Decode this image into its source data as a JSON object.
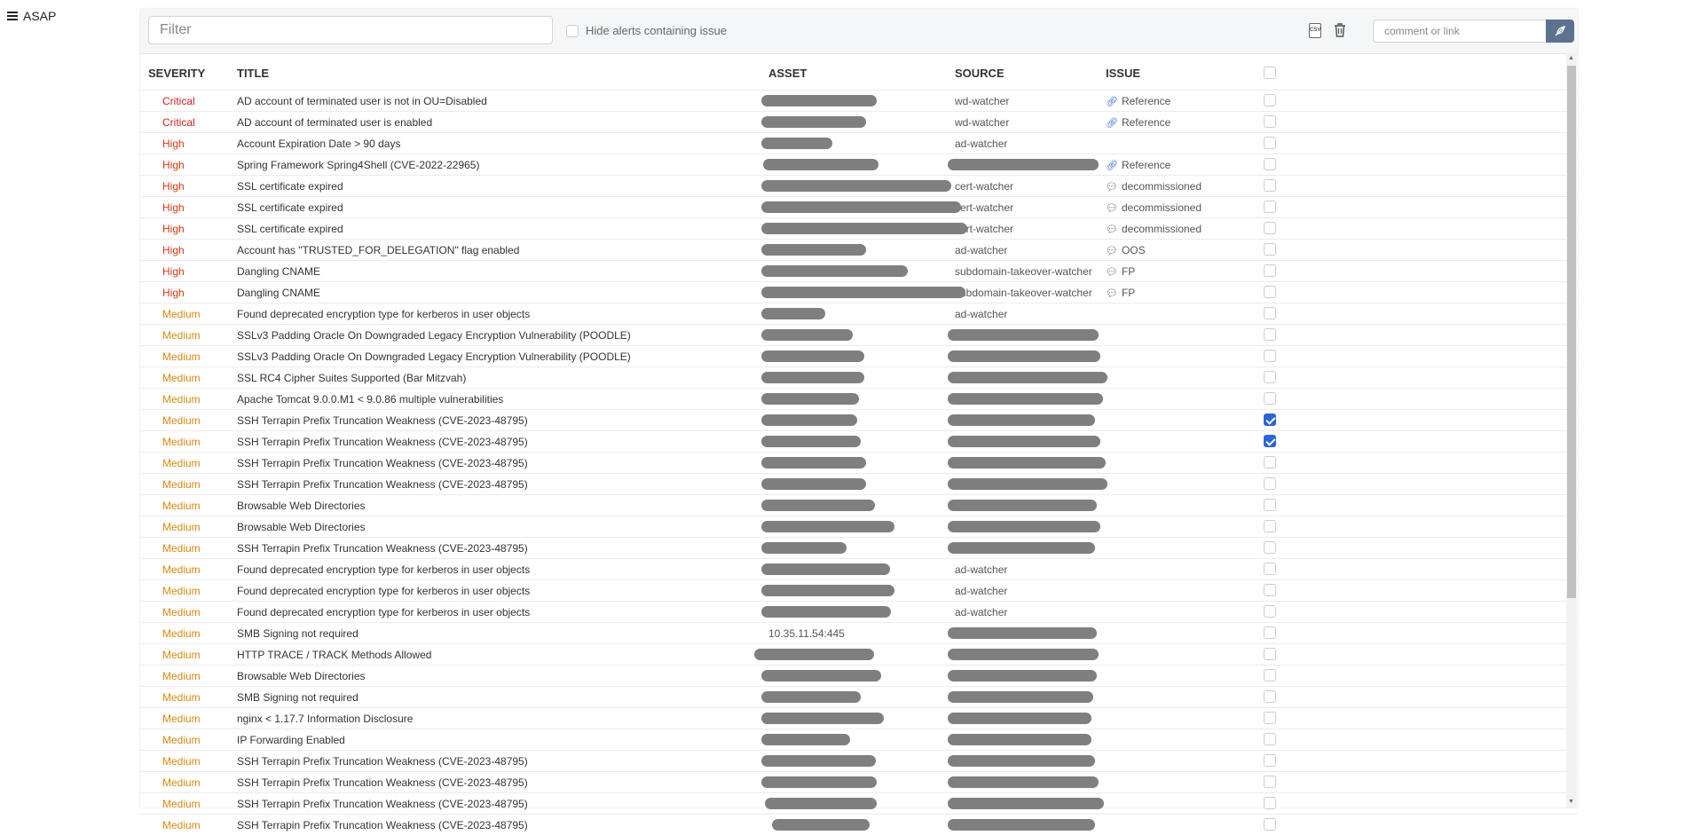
{
  "app": {
    "title": "ASAP"
  },
  "toolbar": {
    "filter_placeholder": "Filter",
    "hide_label": "Hide alerts containing issue",
    "comment_placeholder": "comment or link",
    "csv_label": "CSV"
  },
  "headers": {
    "severity": "SEVERITY",
    "title": "TITLE",
    "asset": "ASSET",
    "source": "SOURCE",
    "issue": "ISSUE"
  },
  "colors": {
    "critical": "#d02020",
    "high": "#d83a10",
    "medium": "#d78a10",
    "accent": "#2b63d9"
  },
  "rows": [
    {
      "severity": "Critical",
      "title": "AD account of terminated user is not in OU=Disabled",
      "asset": "",
      "source": "wd-watcher",
      "issue": "Reference",
      "issue_icon": "link-icon",
      "checked": false
    },
    {
      "severity": "Critical",
      "title": "AD account of terminated user is enabled",
      "asset": "",
      "source": "wd-watcher",
      "issue": "Reference",
      "issue_icon": "link-icon",
      "checked": false
    },
    {
      "severity": "High",
      "title": "Account Expiration Date > 90 days",
      "asset": "",
      "source": "ad-watcher",
      "issue": "",
      "issue_icon": "",
      "checked": false
    },
    {
      "severity": "High",
      "title": "Spring Framework Spring4Shell (CVE-2022-22965)",
      "asset": "",
      "source": "",
      "issue": "Reference",
      "issue_icon": "link-icon",
      "checked": false
    },
    {
      "severity": "High",
      "title": "SSL certificate expired",
      "asset": "",
      "source": "cert-watcher",
      "issue": "decommissioned",
      "issue_icon": "comment-icon",
      "checked": false
    },
    {
      "severity": "High",
      "title": "SSL certificate expired",
      "asset": "",
      "source": "cert-watcher",
      "issue": "decommissioned",
      "issue_icon": "comment-icon",
      "checked": false
    },
    {
      "severity": "High",
      "title": "SSL certificate expired",
      "asset": "",
      "source": "cert-watcher",
      "issue": "decommissioned",
      "issue_icon": "comment-icon",
      "checked": false
    },
    {
      "severity": "High",
      "title": "Account has \"TRUSTED_FOR_DELEGATION\" flag enabled",
      "asset": "",
      "source": "ad-watcher",
      "issue": "OOS",
      "issue_icon": "comment-icon",
      "checked": false
    },
    {
      "severity": "High",
      "title": "Dangling CNAME",
      "asset": "",
      "source": "subdomain-takeover-watcher",
      "issue": "FP",
      "issue_icon": "comment-icon",
      "checked": false
    },
    {
      "severity": "High",
      "title": "Dangling CNAME",
      "asset": "",
      "source": "subdomain-takeover-watcher",
      "issue": "FP",
      "issue_icon": "comment-icon",
      "checked": false
    },
    {
      "severity": "Medium",
      "title": "Found deprecated encryption type for kerberos in user objects",
      "asset": "",
      "source": "ad-watcher",
      "issue": "",
      "issue_icon": "",
      "checked": false
    },
    {
      "severity": "Medium",
      "title": "SSLv3 Padding Oracle On Downgraded Legacy Encryption Vulnerability (POODLE)",
      "asset": "",
      "source": "",
      "issue": "",
      "issue_icon": "",
      "checked": false
    },
    {
      "severity": "Medium",
      "title": "SSLv3 Padding Oracle On Downgraded Legacy Encryption Vulnerability (POODLE)",
      "asset": "",
      "source": "",
      "issue": "",
      "issue_icon": "",
      "checked": false
    },
    {
      "severity": "Medium",
      "title": "SSL RC4 Cipher Suites Supported (Bar Mitzvah)",
      "asset": "",
      "source": "",
      "issue": "",
      "issue_icon": "",
      "checked": false
    },
    {
      "severity": "Medium",
      "title": "Apache Tomcat 9.0.0.M1 < 9.0.86 multiple vulnerabilities",
      "asset": "",
      "source": "",
      "issue": "",
      "issue_icon": "",
      "checked": false
    },
    {
      "severity": "Medium",
      "title": "SSH Terrapin Prefix Truncation Weakness (CVE-2023-48795)",
      "asset": "",
      "source": "",
      "issue": "",
      "issue_icon": "",
      "checked": true
    },
    {
      "severity": "Medium",
      "title": "SSH Terrapin Prefix Truncation Weakness (CVE-2023-48795)",
      "asset": "",
      "source": "",
      "issue": "",
      "issue_icon": "",
      "checked": true
    },
    {
      "severity": "Medium",
      "title": "SSH Terrapin Prefix Truncation Weakness (CVE-2023-48795)",
      "asset": "",
      "source": "",
      "issue": "",
      "issue_icon": "",
      "checked": false
    },
    {
      "severity": "Medium",
      "title": "SSH Terrapin Prefix Truncation Weakness (CVE-2023-48795)",
      "asset": "",
      "source": "",
      "issue": "",
      "issue_icon": "",
      "checked": false
    },
    {
      "severity": "Medium",
      "title": "Browsable Web Directories",
      "asset": "",
      "source": "",
      "issue": "",
      "issue_icon": "",
      "checked": false
    },
    {
      "severity": "Medium",
      "title": "Browsable Web Directories",
      "asset": "",
      "source": "",
      "issue": "",
      "issue_icon": "",
      "checked": false
    },
    {
      "severity": "Medium",
      "title": "SSH Terrapin Prefix Truncation Weakness (CVE-2023-48795)",
      "asset": "",
      "source": "",
      "issue": "",
      "issue_icon": "",
      "checked": false
    },
    {
      "severity": "Medium",
      "title": "Found deprecated encryption type for kerberos in user objects",
      "asset": "",
      "source": "ad-watcher",
      "issue": "",
      "issue_icon": "",
      "checked": false
    },
    {
      "severity": "Medium",
      "title": "Found deprecated encryption type for kerberos in user objects",
      "asset": "",
      "source": "ad-watcher",
      "issue": "",
      "issue_icon": "",
      "checked": false
    },
    {
      "severity": "Medium",
      "title": "Found deprecated encryption type for kerberos in user objects",
      "asset": "",
      "source": "ad-watcher",
      "issue": "",
      "issue_icon": "",
      "checked": false
    },
    {
      "severity": "Medium",
      "title": "SMB Signing not required",
      "asset": "10.35.11.54:445",
      "source": "",
      "issue": "",
      "issue_icon": "",
      "checked": false
    },
    {
      "severity": "Medium",
      "title": "HTTP TRACE / TRACK Methods Allowed",
      "asset": "",
      "source": "",
      "issue": "",
      "issue_icon": "",
      "checked": false
    },
    {
      "severity": "Medium",
      "title": "Browsable Web Directories",
      "asset": "",
      "source": "",
      "issue": "",
      "issue_icon": "",
      "checked": false
    },
    {
      "severity": "Medium",
      "title": "SMB Signing not required",
      "asset": "",
      "source": "",
      "issue": "",
      "issue_icon": "",
      "checked": false
    },
    {
      "severity": "Medium",
      "title": "nginx < 1.17.7 Information Disclosure",
      "asset": "",
      "source": "",
      "issue": "",
      "issue_icon": "",
      "checked": false
    },
    {
      "severity": "Medium",
      "title": "IP Forwarding Enabled",
      "asset": "",
      "source": "",
      "issue": "",
      "issue_icon": "",
      "checked": false
    },
    {
      "severity": "Medium",
      "title": "SSH Terrapin Prefix Truncation Weakness (CVE-2023-48795)",
      "asset": "",
      "source": "",
      "issue": "",
      "issue_icon": "",
      "checked": false
    },
    {
      "severity": "Medium",
      "title": "SSH Terrapin Prefix Truncation Weakness (CVE-2023-48795)",
      "asset": "",
      "source": "",
      "issue": "",
      "issue_icon": "",
      "checked": false
    },
    {
      "severity": "Medium",
      "title": "SSH Terrapin Prefix Truncation Weakness (CVE-2023-48795)",
      "asset": "",
      "source": "",
      "issue": "",
      "issue_icon": "",
      "checked": false
    },
    {
      "severity": "Medium",
      "title": "SSH Terrapin Prefix Truncation Weakness (CVE-2023-48795)",
      "asset": "",
      "source": "",
      "issue": "",
      "issue_icon": "",
      "checked": false
    }
  ]
}
